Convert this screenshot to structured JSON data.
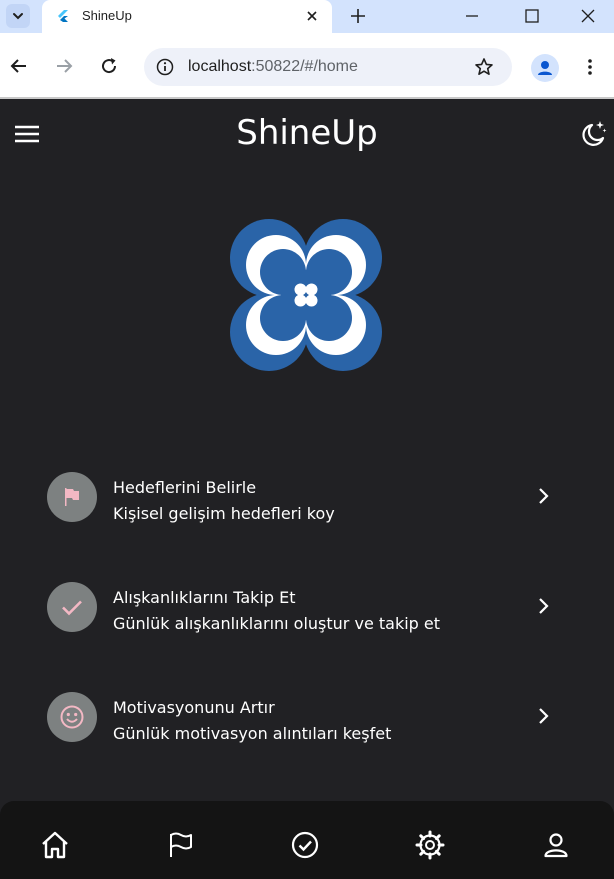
{
  "browser": {
    "tab_title": "ShineUp",
    "url_host": "localhost",
    "url_rest": ":50822/#/home",
    "icons": {
      "tab_search": "chevron-down-icon",
      "favicon": "flutter-icon",
      "close": "close-icon",
      "new_tab": "plus-icon",
      "minimize": "minimize-icon",
      "maximize": "maximize-icon",
      "window_close": "close-icon",
      "back": "arrow-left-icon",
      "forward": "arrow-right-icon",
      "reload": "reload-icon",
      "site_info": "info-icon",
      "bookmark": "star-icon",
      "profile": "person-icon",
      "menu": "kebab-icon"
    }
  },
  "app": {
    "title": "ShineUp",
    "colors": {
      "background": "#212124",
      "bottom_nav": "#141414",
      "avatar_bg": "#7d8181",
      "accent_pink": "#f3b8c4",
      "logo_blue": "#2a64a8"
    },
    "features": [
      {
        "title": "Hedeflerini Belirle",
        "subtitle": "Kişisel gelişim hedefleri koy",
        "icon": "flag-icon"
      },
      {
        "title": "Alışkanlıklarını Takip Et",
        "subtitle": "Günlük alışkanlıklarını oluştur ve takip et",
        "icon": "check-icon"
      },
      {
        "title": "Motivasyonunu Artır",
        "subtitle": "Günlük motivasyon alıntıları keşfet",
        "icon": "smiley-icon"
      }
    ],
    "bottom_nav": [
      {
        "icon": "home-icon"
      },
      {
        "icon": "flag-outline-icon"
      },
      {
        "icon": "check-circle-icon"
      },
      {
        "icon": "settings-icon"
      },
      {
        "icon": "person-outline-icon"
      }
    ]
  }
}
